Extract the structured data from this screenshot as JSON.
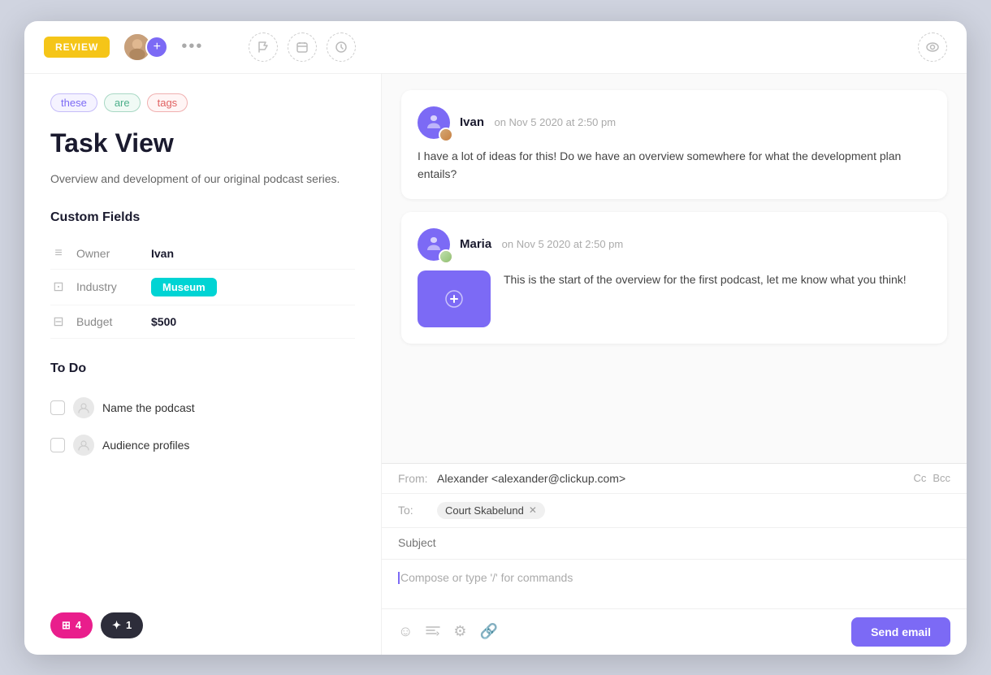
{
  "window": {
    "title": "Task View"
  },
  "topbar": {
    "status": "REVIEW",
    "more_label": "•••",
    "icons": {
      "flag": "⚑",
      "calendar": "◻",
      "clock": "◷",
      "eye": "◎"
    }
  },
  "left": {
    "tags": [
      {
        "text": "these",
        "class": "tag-these"
      },
      {
        "text": "are",
        "class": "tag-are"
      },
      {
        "text": "tags",
        "class": "tag-tags"
      }
    ],
    "title": "Task View",
    "description": "Overview and development of our original podcast series.",
    "custom_fields_title": "Custom Fields",
    "fields": [
      {
        "icon": "≡",
        "label": "Owner",
        "value": "Ivan",
        "type": "text"
      },
      {
        "icon": "⊡",
        "label": "Industry",
        "value": "Museum",
        "type": "badge"
      },
      {
        "icon": "⊟",
        "label": "Budget",
        "value": "$500",
        "type": "text"
      }
    ],
    "todo_title": "To Do",
    "todos": [
      {
        "label": "Name the podcast"
      },
      {
        "label": "Audience profiles"
      }
    ],
    "badges": [
      {
        "icon": "🎯",
        "count": "4",
        "color": "badge-pink"
      },
      {
        "icon": "✦",
        "count": "1",
        "color": "badge-dark"
      }
    ]
  },
  "comments": [
    {
      "author": "Ivan",
      "time": "on Nov 5 2020 at 2:50 pm",
      "text": "I have a lot of ideas for this! Do we have an overview somewhere for what the development plan entails?",
      "has_attachment": false
    },
    {
      "author": "Maria",
      "time": "on Nov 5 2020 at 2:50 pm",
      "text": "This is the start of the overview for the first podcast, let me know what you think!",
      "has_attachment": true
    }
  ],
  "email": {
    "from_label": "From:",
    "from_value": "Alexander <alexander@clickup.com>",
    "cc_label": "Cc",
    "bcc_label": "Bcc",
    "to_label": "To:",
    "to_chip": "Court Skabelund",
    "subject_placeholder": "Subject",
    "compose_placeholder": "Compose or type '/' for commands",
    "send_label": "Send email"
  }
}
